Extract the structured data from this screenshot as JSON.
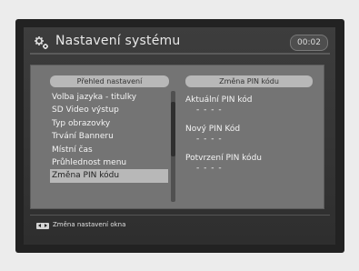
{
  "header": {
    "title": "Nastavení systému",
    "clock": "00:02",
    "icon": "gear-icon"
  },
  "left_panel": {
    "title": "Přehled nastavení",
    "items": [
      {
        "label": "Volba jazyka - titulky",
        "selected": false
      },
      {
        "label": "SD Video výstup",
        "selected": false
      },
      {
        "label": "Typ obrazovky",
        "selected": false
      },
      {
        "label": "Trvání Banneru",
        "selected": false
      },
      {
        "label": "Místní čas",
        "selected": false
      },
      {
        "label": "Průhlednost menu",
        "selected": false
      },
      {
        "label": "Změna PIN kódu",
        "selected": true
      }
    ]
  },
  "right_panel": {
    "title": "Změna PIN kódu",
    "fields": [
      {
        "label": "Aktuální PIN kód",
        "value": "- - - -"
      },
      {
        "label": "Nový PIN Kód",
        "value": "- - - -"
      },
      {
        "label": "Potvrzení PIN kódu",
        "value": "- - - -"
      }
    ]
  },
  "footer": {
    "key_icon": "left-right-keys-icon",
    "hint": "Změna nastavení okna"
  },
  "colors": {
    "background": "#3a3a3a",
    "panel": "#747474",
    "header_pill": "#b8b8b8",
    "selected_row": "#b8b8b8",
    "text": "#f4f4f4"
  }
}
